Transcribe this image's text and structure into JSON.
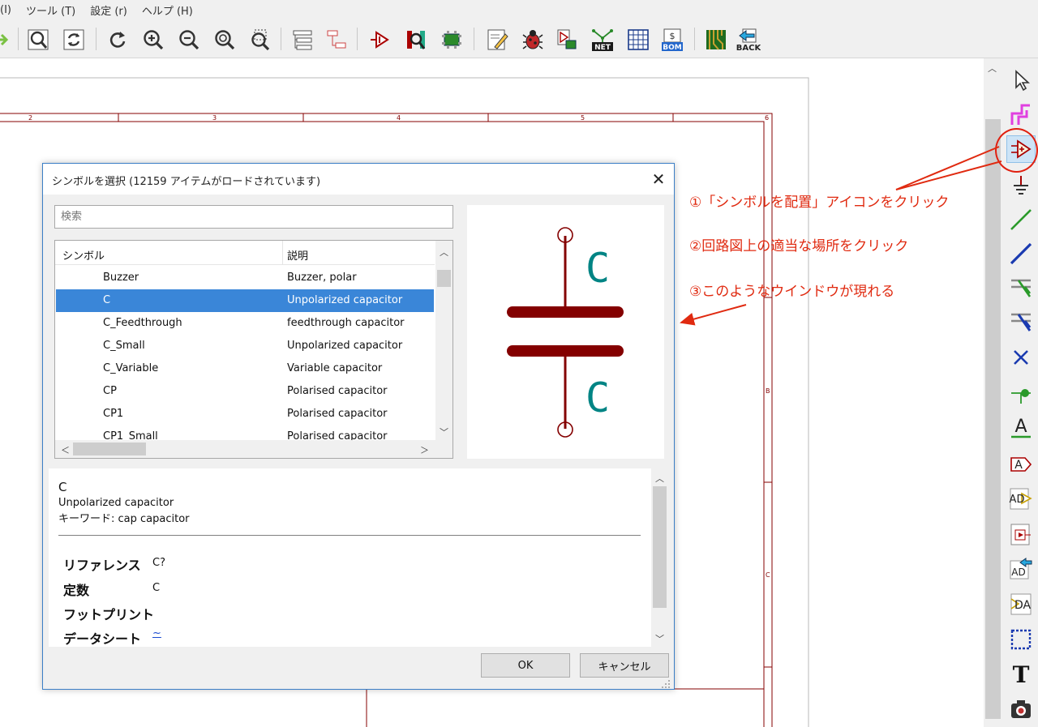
{
  "menu": [
    "(I)",
    "ツール (T)",
    "設定 (r)",
    "ヘルプ (H)"
  ],
  "toolbar": {
    "icons": [
      "arrow-icon",
      "zoom-fit-icon",
      "refresh-icon",
      "redo-icon",
      "zoom-in-icon",
      "zoom-out-icon",
      "zoom-page-icon",
      "zoom-selection-icon",
      "hierarchy-icon",
      "hierarchy-nav-icon",
      "symbol-editor-icon",
      "symbol-library-icon",
      "footprint-editor-icon",
      "annotate-icon",
      "erc-bug-icon",
      "sim-icon",
      "netlist-icon",
      "fields-table-icon",
      "bom-icon",
      "pcbnew-icon",
      "back-icon"
    ],
    "net_label": "NET",
    "bom_label": "BOM",
    "back_label": "BACK"
  },
  "frame": {
    "columns": [
      "2",
      "3",
      "4",
      "5",
      "6"
    ],
    "rows": [
      "B",
      "C"
    ]
  },
  "right_toolbar": [
    "select-arrow-icon",
    "highlight-net-icon",
    "place-symbol-icon",
    "power-ground-icon",
    "wire-icon",
    "bus-icon",
    "wire-entry-icon",
    "bus-entry-icon",
    "no-connect-icon",
    "junction-icon",
    "net-label-icon",
    "global-label-icon",
    "hier-label-icon",
    "hier-sheet-icon",
    "import-sheet-pin-icon",
    "sheet-pin-icon",
    "dashed-line-icon",
    "text-icon",
    "image-icon"
  ],
  "right_letters": {
    "net_label": "A",
    "global_label": "A",
    "hier_label": "AD",
    "import_pin": "AD",
    "sheet_pin": "DA",
    "text": "T"
  },
  "annotations": {
    "step1": "①「シンボルを配置」アイコンをクリック",
    "step2": "②回路図上の適当な場所をクリック",
    "step3": "③このようなウインドウが現れる",
    "color": "#e02a10"
  },
  "dialog": {
    "title": "シンボルを選択 (12159 アイテムがロードされています)",
    "close_glyph": "✕",
    "search_placeholder": "検索",
    "columns": {
      "symbol": "シンボル",
      "description": "説明"
    },
    "rows": [
      {
        "name": "Buzzer",
        "desc": "Buzzer, polar"
      },
      {
        "name": "C",
        "desc": "Unpolarized capacitor"
      },
      {
        "name": "C_Feedthrough",
        "desc": "feedthrough capacitor"
      },
      {
        "name": "C_Small",
        "desc": "Unpolarized capacitor"
      },
      {
        "name": "C_Variable",
        "desc": "Variable capacitor"
      },
      {
        "name": "CP",
        "desc": "Polarised capacitor"
      },
      {
        "name": "CP1",
        "desc": "Polarised capacitor"
      },
      {
        "name": "CP1_Small",
        "desc": "Polarised capacitor"
      }
    ],
    "selected_index": 1,
    "preview": {
      "ref": "C",
      "value": "C",
      "body_color": "#840000",
      "text_color": "#008484"
    },
    "info": {
      "name": "C",
      "description": "Unpolarized capacitor",
      "keywords": "キーワード: cap capacitor",
      "fields": [
        {
          "label": "リファレンス",
          "value": "C?"
        },
        {
          "label": "定数",
          "value": "C"
        },
        {
          "label": "フットプリント",
          "value": ""
        },
        {
          "label": "データシート",
          "value": "~"
        }
      ]
    },
    "ok_label": "OK",
    "cancel_label": "キャンセル"
  },
  "colors": {
    "accent": "#3a86d8",
    "frame": "#840000",
    "dialog_border": "#3c7fc6"
  }
}
